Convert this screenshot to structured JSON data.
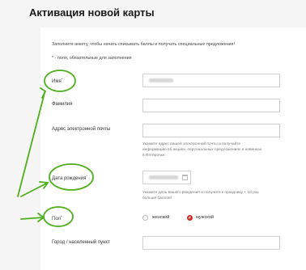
{
  "page_title": "Активация новой карты",
  "intro_text": "Заполните анкету, чтобы начать списывать баллы и получать специальные предложения!",
  "required_note": "* - поля, обязательные для заполнения",
  "fields": {
    "name": {
      "label": "Имя",
      "required_mark": "*"
    },
    "surname": {
      "label": "Фамилия"
    },
    "email": {
      "label": "Адрес электронной почты",
      "hint": [
        "Укажите адрес вашей электронной почты и получайте",
        "информацию об акциях, персональных предложениях и новинках",
        "в Пятёрочке."
      ]
    },
    "birthdate": {
      "label": "Дата рождения",
      "required_mark": "*",
      "hint": [
        "Укажите день вашего рождения и получите к празднику + 10 раз",
        "больше баллов!"
      ]
    },
    "gender": {
      "label": "Пол",
      "required_mark": "*",
      "options": [
        "женский",
        "мужской"
      ],
      "selected": "мужской"
    },
    "city": {
      "label": "Город / населенный пункт"
    }
  },
  "colors": {
    "annotation": "#4caf1a",
    "accent": "#d9261c"
  }
}
